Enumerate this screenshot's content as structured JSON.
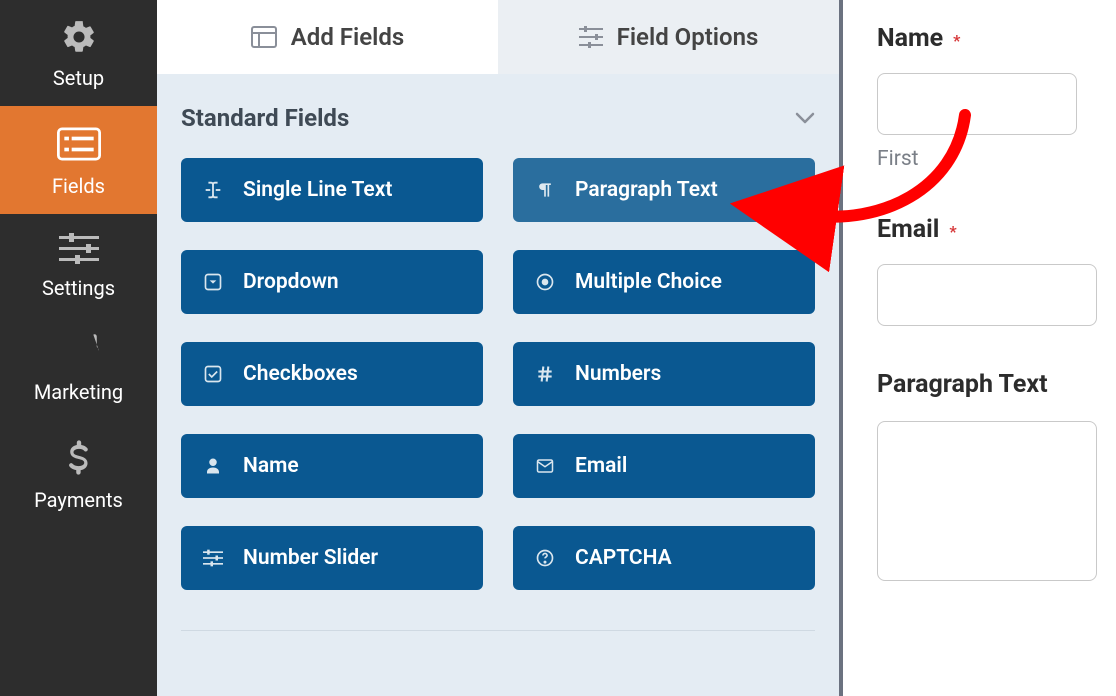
{
  "sidebar": {
    "items": [
      {
        "label": "Setup"
      },
      {
        "label": "Fields"
      },
      {
        "label": "Settings"
      },
      {
        "label": "Marketing"
      },
      {
        "label": "Payments"
      }
    ]
  },
  "tabs": {
    "add": "Add Fields",
    "options": "Field Options"
  },
  "section": {
    "title": "Standard Fields"
  },
  "fields": [
    {
      "label": "Single Line Text"
    },
    {
      "label": "Paragraph Text"
    },
    {
      "label": "Dropdown"
    },
    {
      "label": "Multiple Choice"
    },
    {
      "label": "Checkboxes"
    },
    {
      "label": "Numbers"
    },
    {
      "label": "Name"
    },
    {
      "label": "Email"
    },
    {
      "label": "Number Slider"
    },
    {
      "label": "CAPTCHA"
    }
  ],
  "preview": {
    "name_label": "Name",
    "name_required": "*",
    "name_sub": "First",
    "email_label": "Email",
    "email_required": "*",
    "paragraph_label": "Paragraph Text"
  }
}
